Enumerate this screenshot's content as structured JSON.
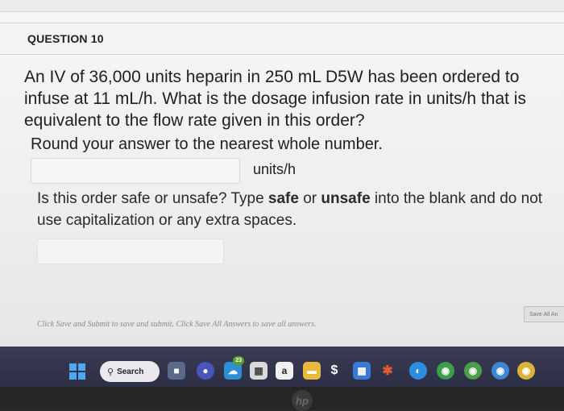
{
  "question": {
    "title": "QUESTION 10",
    "text": "An IV of 36,000 units heparin in 250 mL D5W has been ordered to infuse at 11 mL/h. What is the dosage infusion rate in units/h that is equivalent to the flow rate given in this order?",
    "round_note": "Round your answer to the nearest whole number.",
    "answer_1_value": "",
    "units_label": "units/h",
    "q2_prefix": "Is this order safe or unsafe? Type ",
    "q2_safe": "safe",
    "q2_or": " or ",
    "q2_unsafe": "unsafe",
    "q2_suffix": " into the blank and do not use capitalization or any extra spaces.",
    "answer_2_value": ""
  },
  "footer": {
    "note": "Click Save and Submit to save and submit. Click Save All Answers to save all answers.",
    "save_all_label": "Save All An"
  },
  "taskbar": {
    "search_label": "Search",
    "badge_count": "23",
    "amazon_letter": "a",
    "apps": [
      "start-icon",
      "search",
      "file-explorer-icon",
      "teams-icon",
      "weather-icon",
      "calendar-icon",
      "amazon-icon",
      "files-icon",
      "dollar-icon",
      "store-icon",
      "office-icon",
      "edge-icon",
      "chrome-icon",
      "chrome-icon-2",
      "chrome-icon-3",
      "chrome-icon-4"
    ]
  },
  "device": {
    "logo_text": "hp"
  }
}
